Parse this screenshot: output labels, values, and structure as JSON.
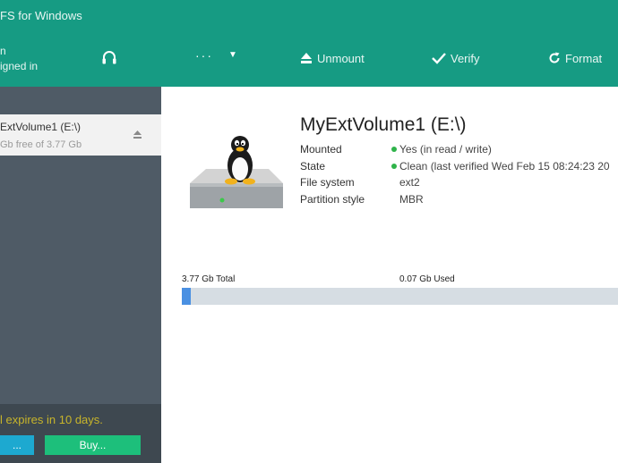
{
  "app": {
    "title": "FS for Windows",
    "signin_line1": "n",
    "signin_line2": "igned in"
  },
  "toolbar": {
    "more_label": "···",
    "unmount_label": "Unmount",
    "verify_label": "Verify",
    "format_label": "Format"
  },
  "sidebar": {
    "volume": {
      "name": "ExtVolume1 (E:\\)",
      "free": "Gb free of 3.77 Gb"
    },
    "trial_text": "l expires in 10 days.",
    "activate_label": "...",
    "buy_label": "Buy..."
  },
  "details": {
    "title": "MyExtVolume1 (E:\\)",
    "rows": [
      {
        "label": "Mounted",
        "value": "Yes (in read / write)"
      },
      {
        "label": "State",
        "value": "Clean (last verified Wed Feb 15 08:24:23 20"
      },
      {
        "label": "File system",
        "value": "ext2"
      },
      {
        "label": "Partition style",
        "value": "MBR"
      }
    ],
    "total_label": "3.77 Gb Total",
    "used_label": "0.07 Gb Used",
    "used_fraction": 0.019
  },
  "colors": {
    "header": "#169b83",
    "sidebar": "#4f5b66",
    "status_ok": "#2fb34a",
    "usage_fill": "#4a90e2"
  }
}
